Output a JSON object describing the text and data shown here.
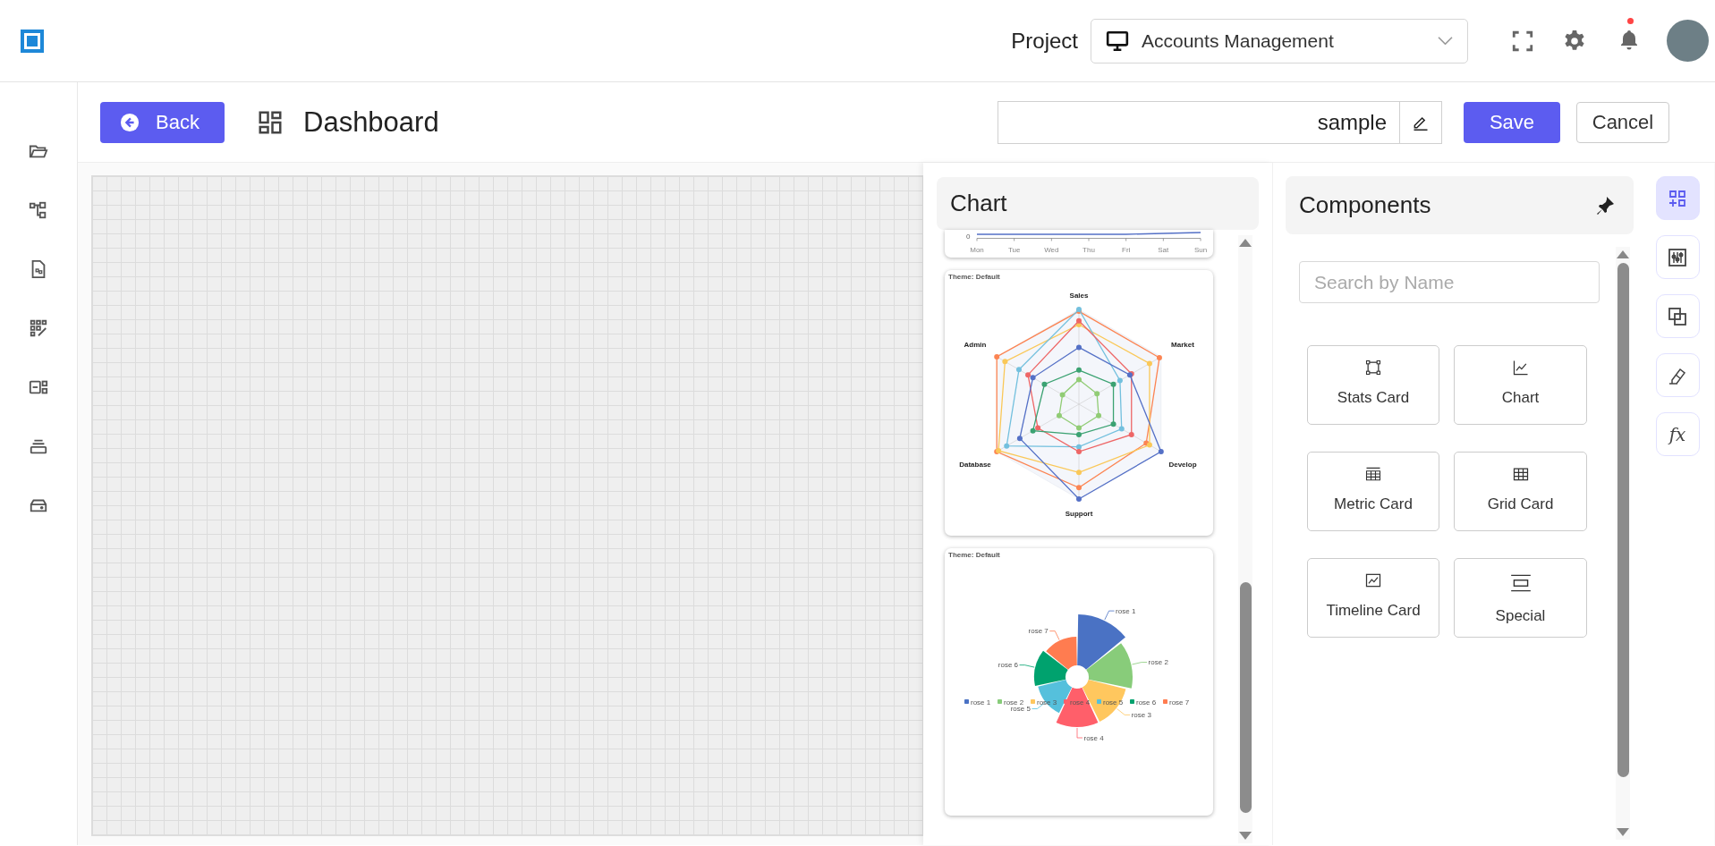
{
  "header": {
    "project_label": "Project",
    "project": "Accounts Management"
  },
  "toolbar": {
    "back": "Back",
    "title": "Dashboard",
    "name_value": "sample",
    "save": "Save",
    "cancel": "Cancel"
  },
  "chart_panel": {
    "title": "Chart",
    "thumbnails": [
      {
        "kind": "line",
        "y_tick": "0",
        "x_labels": [
          "Mon",
          "Tue",
          "Wed",
          "Thu",
          "Fri",
          "Sat",
          "Sun"
        ]
      },
      {
        "kind": "radar",
        "theme": "Theme: Default",
        "axes": [
          "Sales",
          "Market",
          "Develop",
          "Support",
          "Database",
          "Admin"
        ]
      },
      {
        "kind": "rose",
        "theme": "Theme: Default",
        "slices": [
          {
            "label": "rose 1",
            "color": "#4a72c4"
          },
          {
            "label": "rose 2",
            "color": "#88cc7a"
          },
          {
            "label": "rose 3",
            "color": "#ffc75e"
          },
          {
            "label": "rose 4",
            "color": "#ff5f6a"
          },
          {
            "label": "rose 5",
            "color": "#55c0dc"
          },
          {
            "label": "rose 6",
            "color": "#00a26e"
          },
          {
            "label": "rose 7",
            "color": "#ff7c50"
          }
        ],
        "legend": [
          {
            "label": "rose 1",
            "color": "#4a72c4"
          },
          {
            "label": "rose 2",
            "color": "#88cc7a"
          },
          {
            "label": "rose 3",
            "color": "#ffc75e"
          },
          {
            "label": "rose 4",
            "color": "#ff5f6a"
          },
          {
            "label": "rose 5",
            "color": "#55c0dc"
          },
          {
            "label": "rose 6",
            "color": "#00a26e"
          },
          {
            "label": "rose 7",
            "color": "#ff7c50"
          }
        ]
      }
    ]
  },
  "components": {
    "title": "Components",
    "search": {
      "placeholder": "Search by Name"
    },
    "items": [
      "Stats Card",
      "Chart",
      "Metric Card",
      "Grid Card",
      "Timeline Card",
      "Special"
    ]
  },
  "right_rail": {
    "items": [
      {
        "selected": true
      },
      {
        "selected": false
      },
      {
        "selected": false
      },
      {
        "selected": false
      },
      {
        "selected": false,
        "label": "fx"
      }
    ]
  }
}
